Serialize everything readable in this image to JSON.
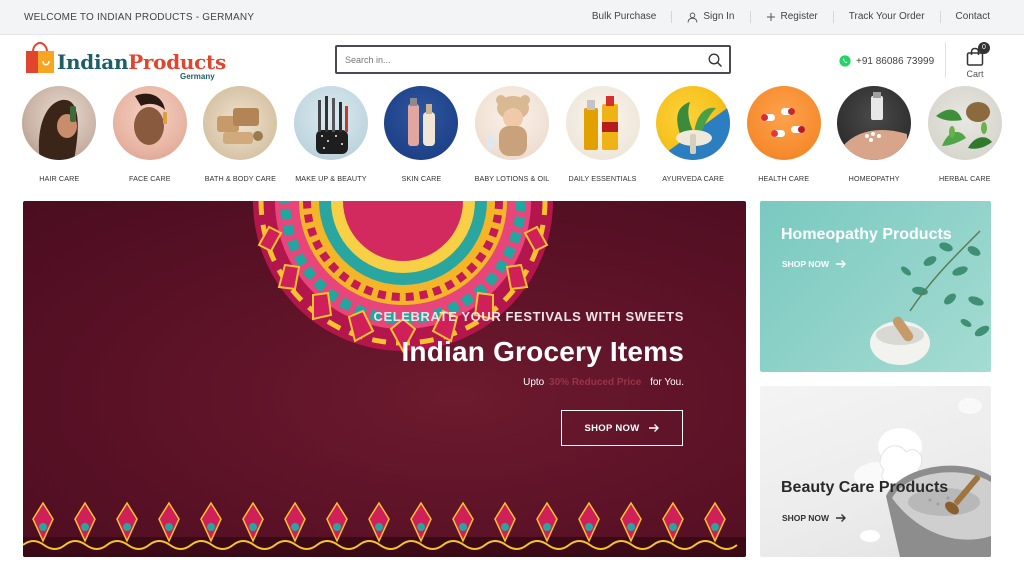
{
  "topbar": {
    "welcome": "WELCOME TO INDIAN PRODUCTS - GERMANY",
    "links": {
      "bulk_purchase": "Bulk Purchase",
      "sign_in": "Sign In",
      "register": "Register",
      "track_order": "Track Your Order",
      "contact": "Contact"
    }
  },
  "header": {
    "logo": {
      "word1": "Indian",
      "word2": "Products",
      "sub": "Germany"
    },
    "search": {
      "placeholder": "Search in..."
    },
    "phone": "+91 86086 73999",
    "cart": {
      "label": "Cart",
      "count": "0"
    }
  },
  "categories": [
    {
      "label": "HAIR CARE"
    },
    {
      "label": "FACE CARE"
    },
    {
      "label": "BATH & BODY CARE"
    },
    {
      "label": "MAKE UP & BEAUTY"
    },
    {
      "label": "SKIN CARE"
    },
    {
      "label": "BABY LOTIONS & OIL"
    },
    {
      "label": "DAILY ESSENTIALS"
    },
    {
      "label": "AYURVEDA CARE"
    },
    {
      "label": "HEALTH CARE"
    },
    {
      "label": "HOMEOPATHY"
    },
    {
      "label": "HERBAL CARE"
    }
  ],
  "hero": {
    "subtitle": "CELEBRATE YOUR FESTIVALS WITH SWEETS",
    "title": "Indian Grocery Items",
    "line_prefix": "Upto",
    "line_highlight": "30% Reduced Price",
    "line_suffix": "for You.",
    "button": "SHOP NOW"
  },
  "side_banners": {
    "homeopathy": {
      "title": "Homeopathy Products",
      "button": "SHOP NOW"
    },
    "beauty": {
      "title": "Beauty Care Products",
      "button": "SHOP NOW"
    }
  },
  "colors": {
    "hero_bg": "#5a1126",
    "accent_highlight": "#9a3347",
    "logo_teal": "#1f5e66",
    "logo_red": "#e2452f",
    "homeopathy_bg": "#8fd2c9",
    "whatsapp": "#25d366"
  },
  "icons": {
    "sign_in": "user-icon",
    "register": "plus-icon",
    "search": "search-icon",
    "phone": "whatsapp-icon",
    "cart": "shopping-bag-icon",
    "shop_now": "arrow-right-icon"
  }
}
